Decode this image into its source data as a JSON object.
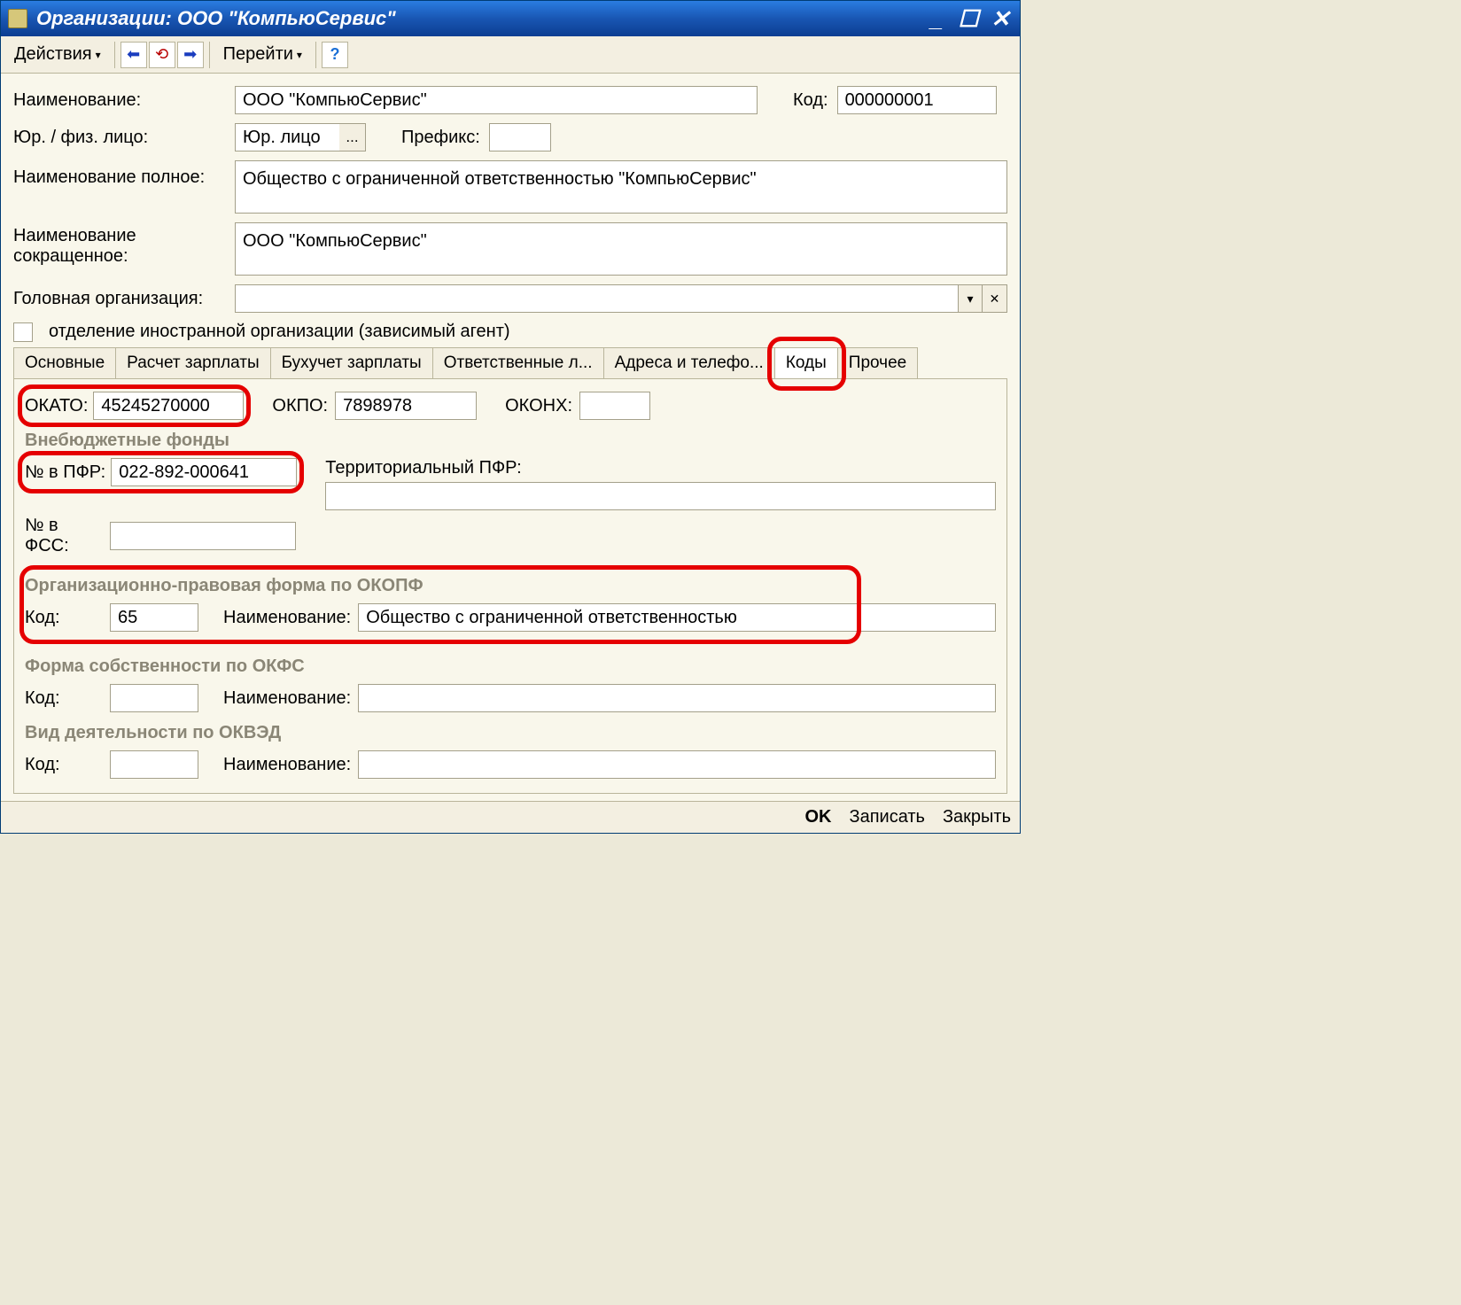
{
  "window": {
    "title": "Организации: ООО \"КомпьюСервис\""
  },
  "toolbar": {
    "actions": "Действия",
    "goto": "Перейти",
    "help": "?"
  },
  "form": {
    "name_label": "Наименование:",
    "name_value": "ООО \"КомпьюСервис\"",
    "code_label": "Код:",
    "code_value": "000000001",
    "entity_type_label": "Юр. / физ. лицо:",
    "entity_type_value": "Юр. лицо",
    "prefix_label": "Префикс:",
    "prefix_value": "",
    "full_name_label": "Наименование полное:",
    "full_name_value": "Общество с ограниченной ответственностью \"КомпьюСервис\"",
    "short_name_label": "Наименование сокращенное:",
    "short_name_value": "ООО \"КомпьюСервис\"",
    "head_org_label": "Головная организация:",
    "head_org_value": "",
    "foreign_branch_label": "отделение иностранной организации (зависимый агент)"
  },
  "tabs": {
    "t0": "Основные",
    "t1": "Расчет зарплаты",
    "t2": "Бухучет зарплаты",
    "t3": "Ответственные л...",
    "t4": "Адреса и телефо...",
    "t5": "Коды",
    "t6": "Прочее"
  },
  "codes": {
    "okato_label": "ОКАТО:",
    "okato_value": "45245270000",
    "okpo_label": "ОКПО:",
    "okpo_value": "7898978",
    "okonh_label": "ОКОНХ:",
    "okonh_value": "",
    "funds_title": "Внебюджетные фонды",
    "pfr_no_label": "№ в ПФР:",
    "pfr_no_value": "022-892-000641",
    "terr_pfr_label": "Территориальный ПФР:",
    "terr_pfr_value": "",
    "fss_no_label": "№ в ФСС:",
    "fss_no_value": "",
    "okopf_title": "Организационно-правовая форма по ОКОПФ",
    "okopf_code_label": "Код:",
    "okopf_code_value": "65",
    "okopf_name_label": "Наименование:",
    "okopf_name_value": "Общество с ограниченной ответственностью",
    "okfs_title": "Форма собственности по ОКФС",
    "okfs_code_label": "Код:",
    "okfs_code_value": "",
    "okfs_name_label": "Наименование:",
    "okfs_name_value": "",
    "okved_title": "Вид деятельности по ОКВЭД",
    "okved_code_label": "Код:",
    "okved_code_value": "",
    "okved_name_label": "Наименование:",
    "okved_name_value": ""
  },
  "footer": {
    "ok": "OK",
    "save": "Записать",
    "close": "Закрыть"
  }
}
